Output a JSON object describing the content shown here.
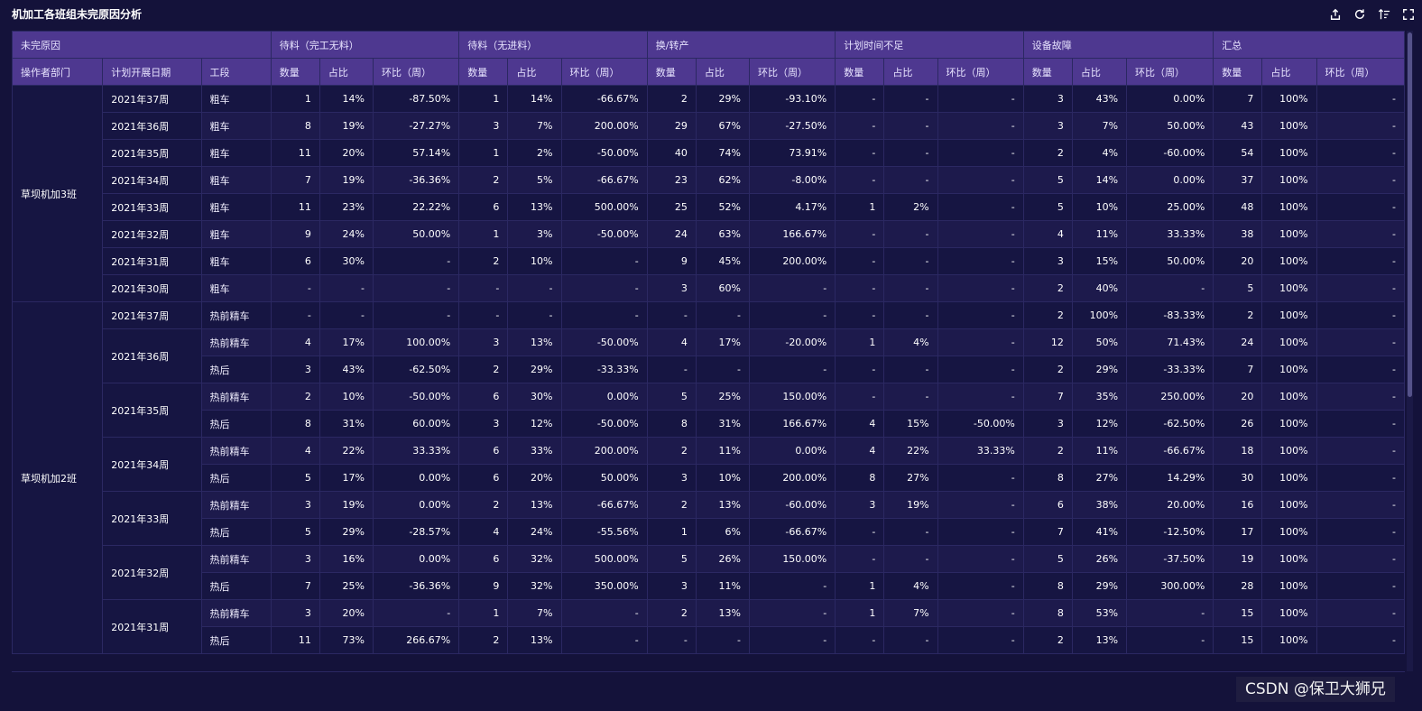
{
  "title": "机加工各班组未完原因分析",
  "toolbar": [
    {
      "icon": "export-icon"
    },
    {
      "icon": "refresh-icon"
    },
    {
      "icon": "sort-icon"
    },
    {
      "icon": "fullscreen-icon"
    }
  ],
  "header": {
    "corner": "未完原因",
    "groups": [
      "待料（完工无料）",
      "待料（无进料）",
      "换/转产",
      "计划时间不足",
      "设备故障",
      "汇总"
    ],
    "dims": [
      "操作者部门",
      "计划开展日期",
      "工段"
    ],
    "metrics": [
      "数量",
      "占比",
      "环比（周）"
    ]
  },
  "sections": [
    {
      "dept": "草坝机加3班",
      "weeks": [
        {
          "week": "2021年37周",
          "rows": [
            {
              "stage": "粗车",
              "cells": [
                "1",
                "14%",
                "-87.50%",
                "1",
                "14%",
                "-66.67%",
                "2",
                "29%",
                "-93.10%",
                "-",
                "-",
                "-",
                "3",
                "43%",
                "0.00%",
                "7",
                "100%",
                "-"
              ]
            }
          ]
        },
        {
          "week": "2021年36周",
          "rows": [
            {
              "stage": "粗车",
              "cells": [
                "8",
                "19%",
                "-27.27%",
                "3",
                "7%",
                "200.00%",
                "29",
                "67%",
                "-27.50%",
                "-",
                "-",
                "-",
                "3",
                "7%",
                "50.00%",
                "43",
                "100%",
                "-"
              ]
            }
          ]
        },
        {
          "week": "2021年35周",
          "rows": [
            {
              "stage": "粗车",
              "cells": [
                "11",
                "20%",
                "57.14%",
                "1",
                "2%",
                "-50.00%",
                "40",
                "74%",
                "73.91%",
                "-",
                "-",
                "-",
                "2",
                "4%",
                "-60.00%",
                "54",
                "100%",
                "-"
              ]
            }
          ]
        },
        {
          "week": "2021年34周",
          "rows": [
            {
              "stage": "粗车",
              "cells": [
                "7",
                "19%",
                "-36.36%",
                "2",
                "5%",
                "-66.67%",
                "23",
                "62%",
                "-8.00%",
                "-",
                "-",
                "-",
                "5",
                "14%",
                "0.00%",
                "37",
                "100%",
                "-"
              ]
            }
          ]
        },
        {
          "week": "2021年33周",
          "rows": [
            {
              "stage": "粗车",
              "cells": [
                "11",
                "23%",
                "22.22%",
                "6",
                "13%",
                "500.00%",
                "25",
                "52%",
                "4.17%",
                "1",
                "2%",
                "-",
                "5",
                "10%",
                "25.00%",
                "48",
                "100%",
                "-"
              ]
            }
          ]
        },
        {
          "week": "2021年32周",
          "rows": [
            {
              "stage": "粗车",
              "cells": [
                "9",
                "24%",
                "50.00%",
                "1",
                "3%",
                "-50.00%",
                "24",
                "63%",
                "166.67%",
                "-",
                "-",
                "-",
                "4",
                "11%",
                "33.33%",
                "38",
                "100%",
                "-"
              ]
            }
          ]
        },
        {
          "week": "2021年31周",
          "rows": [
            {
              "stage": "粗车",
              "cells": [
                "6",
                "30%",
                "-",
                "2",
                "10%",
                "-",
                "9",
                "45%",
                "200.00%",
                "-",
                "-",
                "-",
                "3",
                "15%",
                "50.00%",
                "20",
                "100%",
                "-"
              ]
            }
          ]
        },
        {
          "week": "2021年30周",
          "rows": [
            {
              "stage": "粗车",
              "cells": [
                "-",
                "-",
                "-",
                "-",
                "-",
                "-",
                "3",
                "60%",
                "-",
                "-",
                "-",
                "-",
                "2",
                "40%",
                "-",
                "5",
                "100%",
                "-"
              ]
            }
          ]
        }
      ]
    },
    {
      "dept": "草坝机加2班",
      "weeks": [
        {
          "week": "2021年37周",
          "rows": [
            {
              "stage": "热前精车",
              "cells": [
                "-",
                "-",
                "-",
                "-",
                "-",
                "-",
                "-",
                "-",
                "-",
                "-",
                "-",
                "-",
                "2",
                "100%",
                "-83.33%",
                "2",
                "100%",
                "-"
              ]
            }
          ]
        },
        {
          "week": "2021年36周",
          "rows": [
            {
              "stage": "热前精车",
              "cells": [
                "4",
                "17%",
                "100.00%",
                "3",
                "13%",
                "-50.00%",
                "4",
                "17%",
                "-20.00%",
                "1",
                "4%",
                "-",
                "12",
                "50%",
                "71.43%",
                "24",
                "100%",
                "-"
              ]
            },
            {
              "stage": "热后",
              "cells": [
                "3",
                "43%",
                "-62.50%",
                "2",
                "29%",
                "-33.33%",
                "-",
                "-",
                "-",
                "-",
                "-",
                "-",
                "2",
                "29%",
                "-33.33%",
                "7",
                "100%",
                "-"
              ]
            }
          ]
        },
        {
          "week": "2021年35周",
          "rows": [
            {
              "stage": "热前精车",
              "cells": [
                "2",
                "10%",
                "-50.00%",
                "6",
                "30%",
                "0.00%",
                "5",
                "25%",
                "150.00%",
                "-",
                "-",
                "-",
                "7",
                "35%",
                "250.00%",
                "20",
                "100%",
                "-"
              ]
            },
            {
              "stage": "热后",
              "cells": [
                "8",
                "31%",
                "60.00%",
                "3",
                "12%",
                "-50.00%",
                "8",
                "31%",
                "166.67%",
                "4",
                "15%",
                "-50.00%",
                "3",
                "12%",
                "-62.50%",
                "26",
                "100%",
                "-"
              ]
            }
          ]
        },
        {
          "week": "2021年34周",
          "rows": [
            {
              "stage": "热前精车",
              "cells": [
                "4",
                "22%",
                "33.33%",
                "6",
                "33%",
                "200.00%",
                "2",
                "11%",
                "0.00%",
                "4",
                "22%",
                "33.33%",
                "2",
                "11%",
                "-66.67%",
                "18",
                "100%",
                "-"
              ]
            },
            {
              "stage": "热后",
              "cells": [
                "5",
                "17%",
                "0.00%",
                "6",
                "20%",
                "50.00%",
                "3",
                "10%",
                "200.00%",
                "8",
                "27%",
                "-",
                "8",
                "27%",
                "14.29%",
                "30",
                "100%",
                "-"
              ]
            }
          ]
        },
        {
          "week": "2021年33周",
          "rows": [
            {
              "stage": "热前精车",
              "cells": [
                "3",
                "19%",
                "0.00%",
                "2",
                "13%",
                "-66.67%",
                "2",
                "13%",
                "-60.00%",
                "3",
                "19%",
                "-",
                "6",
                "38%",
                "20.00%",
                "16",
                "100%",
                "-"
              ]
            },
            {
              "stage": "热后",
              "cells": [
                "5",
                "29%",
                "-28.57%",
                "4",
                "24%",
                "-55.56%",
                "1",
                "6%",
                "-66.67%",
                "-",
                "-",
                "-",
                "7",
                "41%",
                "-12.50%",
                "17",
                "100%",
                "-"
              ]
            }
          ]
        },
        {
          "week": "2021年32周",
          "rows": [
            {
              "stage": "热前精车",
              "cells": [
                "3",
                "16%",
                "0.00%",
                "6",
                "32%",
                "500.00%",
                "5",
                "26%",
                "150.00%",
                "-",
                "-",
                "-",
                "5",
                "26%",
                "-37.50%",
                "19",
                "100%",
                "-"
              ]
            },
            {
              "stage": "热后",
              "cells": [
                "7",
                "25%",
                "-36.36%",
                "9",
                "32%",
                "350.00%",
                "3",
                "11%",
                "-",
                "1",
                "4%",
                "-",
                "8",
                "29%",
                "300.00%",
                "28",
                "100%",
                "-"
              ]
            }
          ]
        },
        {
          "week": "2021年31周",
          "rows": [
            {
              "stage": "热前精车",
              "cells": [
                "3",
                "20%",
                "-",
                "1",
                "7%",
                "-",
                "2",
                "13%",
                "-",
                "1",
                "7%",
                "-",
                "8",
                "53%",
                "-",
                "15",
                "100%",
                "-"
              ]
            },
            {
              "stage": "热后",
              "cells": [
                "11",
                "73%",
                "266.67%",
                "2",
                "13%",
                "-",
                "-",
                "-",
                "-",
                "-",
                "-",
                "-",
                "2",
                "13%",
                "-",
                "15",
                "100%",
                "-"
              ]
            }
          ]
        }
      ]
    }
  ],
  "watermark": "CSDN @保卫大狮兄"
}
